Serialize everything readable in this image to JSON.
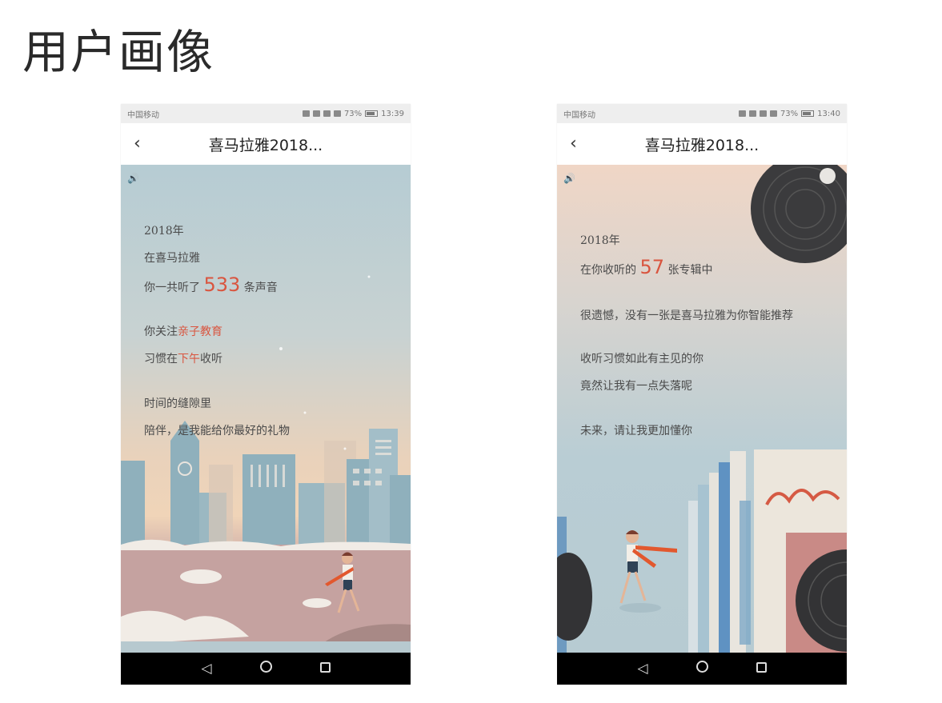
{
  "slide": {
    "title": "用户画像"
  },
  "phone_left": {
    "status": {
      "carrier": "中国移动",
      "battery": "73%",
      "time": "13:39"
    },
    "nav": {
      "back": "‹",
      "title": "喜马拉雅2018..."
    },
    "lines": {
      "year": "2018年",
      "at": "在喜马拉雅",
      "listened_pre": "你一共听了",
      "listened_count": "533",
      "listened_post": "条声音",
      "follow_pre": "你关注",
      "follow_topic": "亲子教育",
      "habit_pre": "习惯在",
      "habit_time": "下午",
      "habit_post": "收听",
      "gap": "时间的缝隙里",
      "gift": "陪伴，是我能给你最好的礼物"
    }
  },
  "phone_right": {
    "status": {
      "carrier": "中国移动",
      "battery": "73%",
      "time": "13:40"
    },
    "nav": {
      "back": "‹",
      "title": "喜马拉雅2018..."
    },
    "lines": {
      "year": "2018年",
      "albums_pre": "在你收听的",
      "albums_count": "57",
      "albums_post": "张专辑中",
      "regret": "很遗憾，没有一张是喜马拉雅为你智能推荐",
      "habit": "收听习惯如此有主见的你",
      "lost": "竟然让我有一点失落呢",
      "future": "未来，请让我更加懂你"
    }
  },
  "colors": {
    "accent": "#d9553f",
    "text": "#4a4a4a",
    "nav_bg": "#000000"
  },
  "icons": [
    "back-icon",
    "sound-icon",
    "nav-back-icon",
    "nav-home-icon",
    "nav-recent-icon"
  ]
}
